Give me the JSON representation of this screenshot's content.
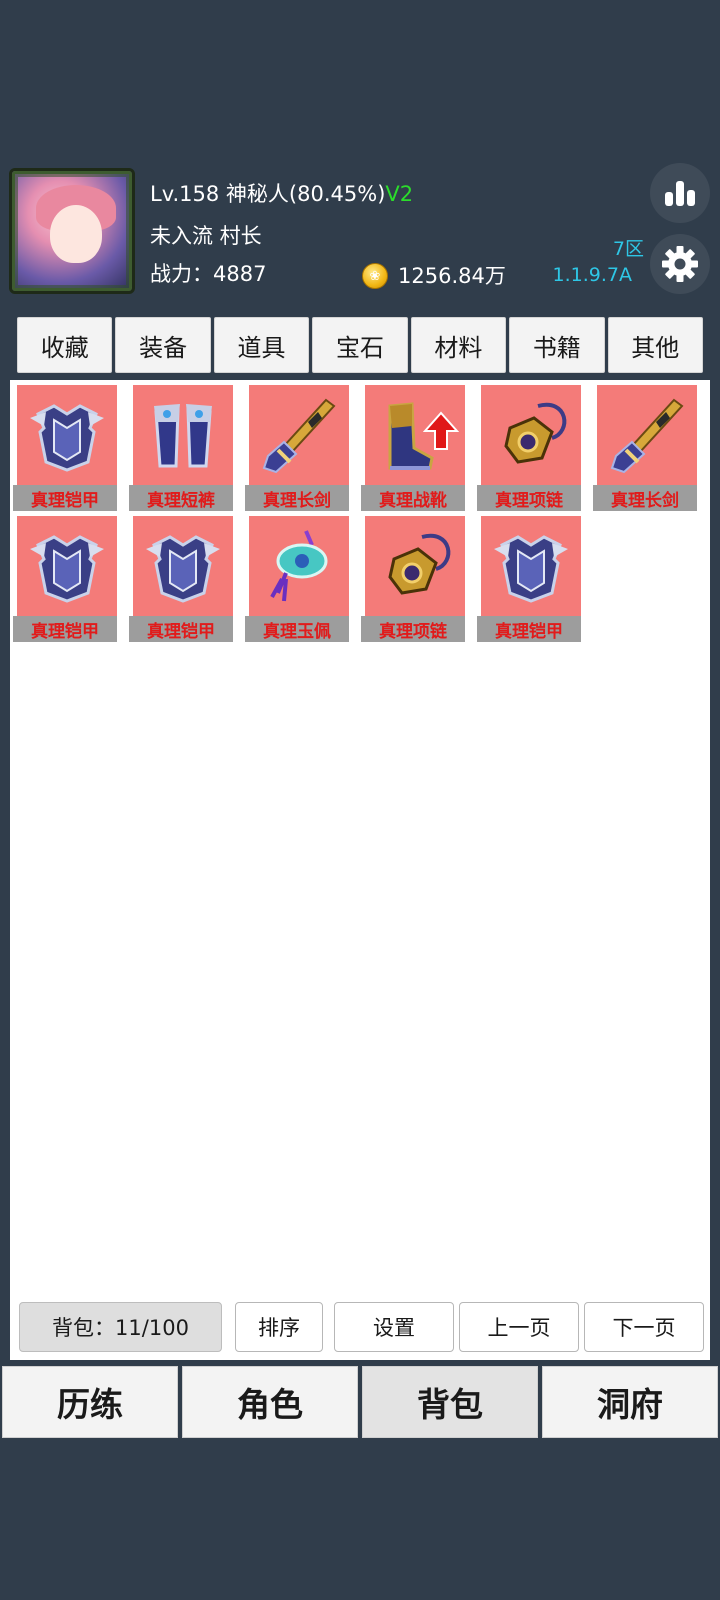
{
  "player": {
    "level_name": "Lv.158 神秘人(80.45%)",
    "vip": "V2",
    "titles": "未入流 村长",
    "power_label": "战力：",
    "power_value": "4887",
    "coins": "1256.84万",
    "server": "7区",
    "version": "1.1.9.7A"
  },
  "tabs": [
    "收藏",
    "装备",
    "道具",
    "宝石",
    "材料",
    "书籍",
    "其他"
  ],
  "inventory": {
    "items": [
      {
        "name": "真理铠甲",
        "icon": "armor-icon",
        "upgrade": false
      },
      {
        "name": "真理短裤",
        "icon": "leggings-icon",
        "upgrade": false
      },
      {
        "name": "真理长剑",
        "icon": "sword-icon",
        "upgrade": false
      },
      {
        "name": "真理战靴",
        "icon": "boots-icon",
        "upgrade": true
      },
      {
        "name": "真理项链",
        "icon": "necklace-icon",
        "upgrade": false
      },
      {
        "name": "真理长剑",
        "icon": "sword-icon",
        "upgrade": false
      },
      {
        "name": "真理铠甲",
        "icon": "armor-icon",
        "upgrade": false
      },
      {
        "name": "真理铠甲",
        "icon": "armor-icon",
        "upgrade": false
      },
      {
        "name": "真理玉佩",
        "icon": "jade-pendant-icon",
        "upgrade": false
      },
      {
        "name": "真理项链",
        "icon": "necklace-icon",
        "upgrade": false
      },
      {
        "name": "真理铠甲",
        "icon": "armor-icon",
        "upgrade": false
      }
    ],
    "item_color": "#f47b79",
    "label_color": "#e11b1b"
  },
  "controls": {
    "bag_count": "背包：11/100",
    "sort": "排序",
    "settings": "设置",
    "prev_page": "上一页",
    "next_page": "下一页"
  },
  "nav": {
    "items": [
      "历练",
      "角色",
      "背包",
      "洞府"
    ],
    "active": "背包"
  },
  "colors": {
    "background": "#303d4b",
    "accent": "#2ec7e6",
    "vip": "#2bdc2b"
  }
}
